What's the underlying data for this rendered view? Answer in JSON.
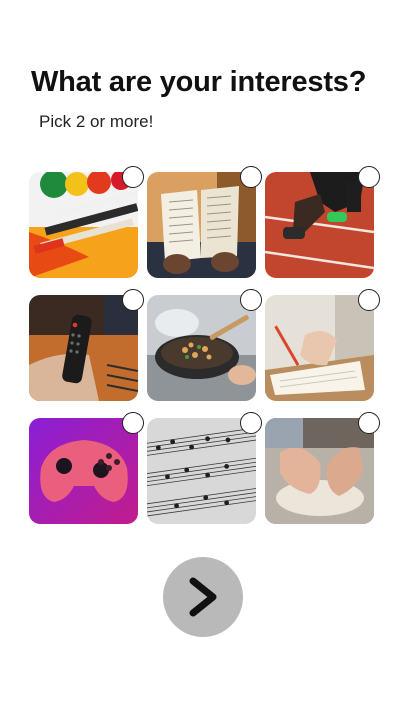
{
  "header": {
    "title": "What are your interests?",
    "subtitle": "Pick 2 or more!"
  },
  "interests": [
    {
      "icon": "painting-image",
      "selected": false
    },
    {
      "icon": "reading-book-image",
      "selected": false
    },
    {
      "icon": "running-track-image",
      "selected": false
    },
    {
      "icon": "tv-remote-image",
      "selected": false
    },
    {
      "icon": "cooking-pan-image",
      "selected": false
    },
    {
      "icon": "writing-notebook-image",
      "selected": false
    },
    {
      "icon": "gaming-controller-image",
      "selected": false
    },
    {
      "icon": "sheet-music-image",
      "selected": false
    },
    {
      "icon": "baking-dough-image",
      "selected": false
    }
  ],
  "next_button": {
    "icon": "chevron-right-icon",
    "background": "#b9b9b9"
  }
}
